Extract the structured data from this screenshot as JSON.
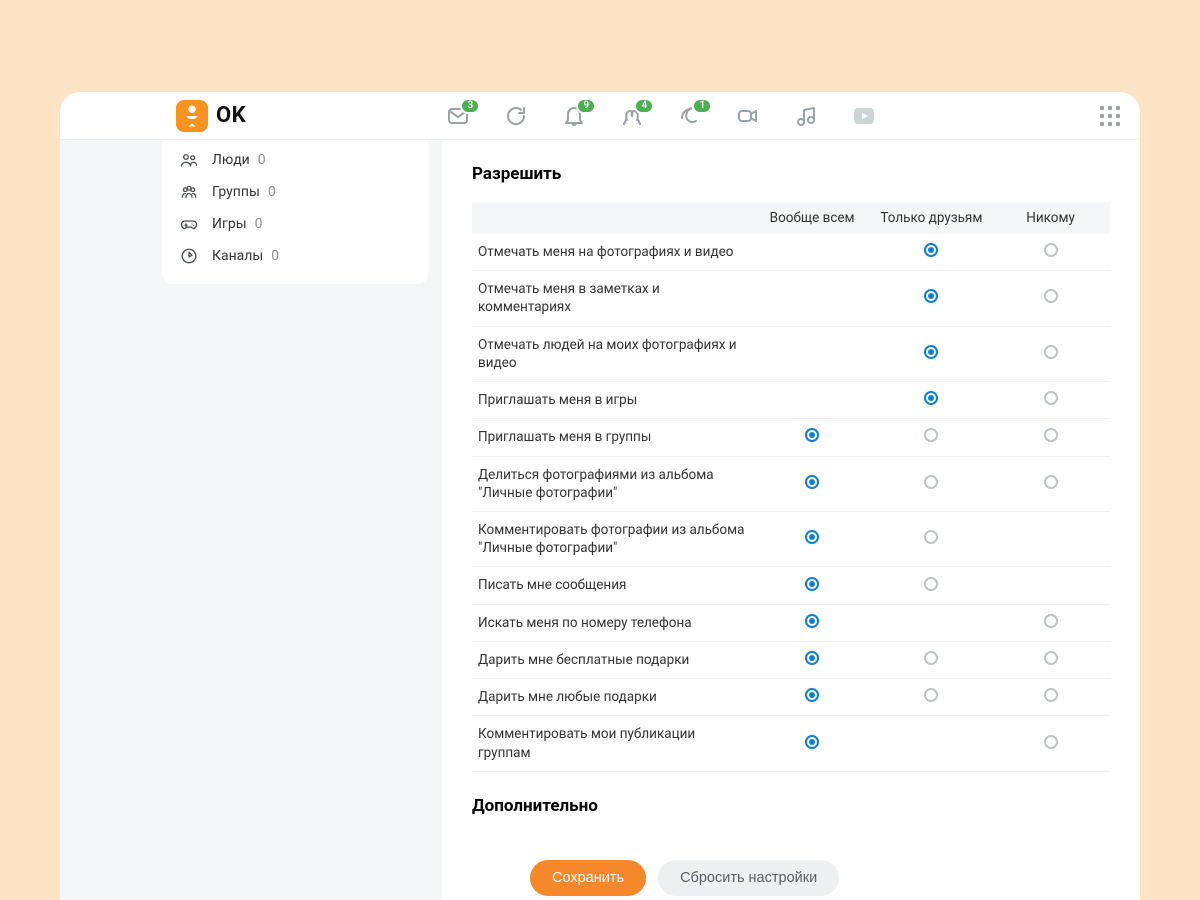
{
  "brand": {
    "name": "OK"
  },
  "nav": {
    "badges": {
      "messages": "3",
      "notifications": "9",
      "guests": "4",
      "events": "1"
    }
  },
  "sidebar": {
    "items": [
      {
        "label": "Люди",
        "count": "0"
      },
      {
        "label": "Группы",
        "count": "0"
      },
      {
        "label": "Игры",
        "count": "0"
      },
      {
        "label": "Каналы",
        "count": "0"
      }
    ]
  },
  "settings": {
    "section_title": "Разрешить",
    "columns": {
      "all": "Вообще всем",
      "friends": "Только друзьям",
      "none": "Никому"
    },
    "rows": [
      {
        "label": "Отмечать меня на фотографиях и видео",
        "cells": [
          null,
          "sel",
          "off"
        ]
      },
      {
        "label": "Отмечать меня в заметках и комментариях",
        "cells": [
          null,
          "sel",
          "off"
        ]
      },
      {
        "label": "Отмечать людей на моих фотографиях и видео",
        "cells": [
          null,
          "sel",
          "off"
        ]
      },
      {
        "label": "Приглашать меня в игры",
        "cells": [
          null,
          "sel",
          "off"
        ]
      },
      {
        "label": "Приглашать меня в группы",
        "cells": [
          "sel",
          "off",
          "off"
        ]
      },
      {
        "label": "Делиться фотографиями из альбома \"Личные фотографии\"",
        "cells": [
          "sel",
          "off",
          "off"
        ]
      },
      {
        "label": "Комментировать фотографии из альбома \"Личные фотографии\"",
        "cells": [
          "sel",
          "off",
          null
        ]
      },
      {
        "label": "Писать мне сообщения",
        "cells": [
          "sel",
          "off",
          null
        ]
      },
      {
        "label": "Искать меня по номеру телефона",
        "cells": [
          "sel",
          null,
          "off"
        ]
      },
      {
        "label": "Дарить мне бесплатные подарки",
        "cells": [
          "sel",
          "off",
          "off"
        ]
      },
      {
        "label": "Дарить мне любые подарки",
        "cells": [
          "sel",
          "off",
          "off"
        ]
      },
      {
        "label": "Комментировать мои публикации группам",
        "cells": [
          "sel",
          null,
          "off"
        ]
      }
    ],
    "additional_title": "Дополнительно",
    "save_label": "Сохранить",
    "reset_label": "Сбросить настройки"
  }
}
